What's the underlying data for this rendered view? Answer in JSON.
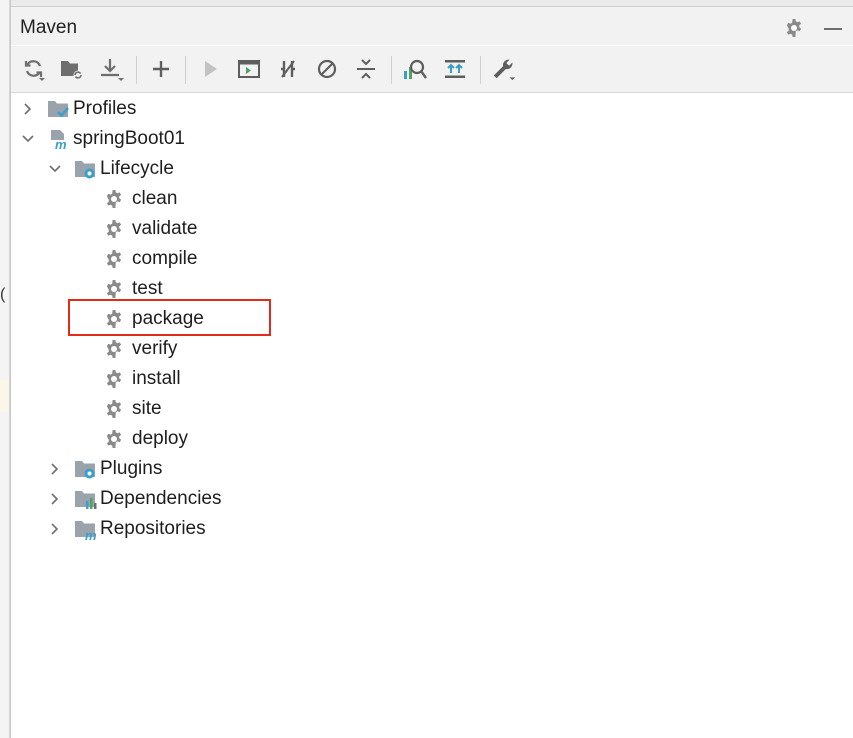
{
  "panel": {
    "title": "Maven"
  },
  "toolbar": {
    "buttons": [
      {
        "name": "reload-all-maven-projects-button",
        "icon": "reload-icon"
      },
      {
        "name": "generate-sources-button",
        "icon": "folder-refresh-icon"
      },
      {
        "name": "download-sources-button",
        "icon": "download-icon"
      },
      {
        "name": "add-maven-project-button",
        "icon": "plus-icon"
      },
      {
        "name": "run-maven-build-button",
        "icon": "play-icon"
      },
      {
        "name": "execute-maven-goal-button",
        "icon": "terminal-icon"
      },
      {
        "name": "toggle-offline-mode-button",
        "icon": "offline-icon"
      },
      {
        "name": "skip-tests-button",
        "icon": "skip-icon"
      },
      {
        "name": "collapse-all-button",
        "icon": "collapse-icon"
      },
      {
        "name": "show-dependencies-button",
        "icon": "analyze-icon"
      },
      {
        "name": "expand-all-button",
        "icon": "expand-icon"
      },
      {
        "name": "maven-settings-button",
        "icon": "wrench-icon"
      }
    ]
  },
  "tree": {
    "profiles": "Profiles",
    "project": "springBoot01",
    "lifecycle": "Lifecycle",
    "goals": [
      "clean",
      "validate",
      "compile",
      "test",
      "package",
      "verify",
      "install",
      "site",
      "deploy"
    ],
    "plugins": "Plugins",
    "dependencies": "Dependencies",
    "repositories": "Repositories"
  },
  "highlighted_item": "package",
  "colors": {
    "accent": "#3b9fcc",
    "highlight_border": "#e32b1a",
    "icon_gray": "#7b7b7b"
  }
}
